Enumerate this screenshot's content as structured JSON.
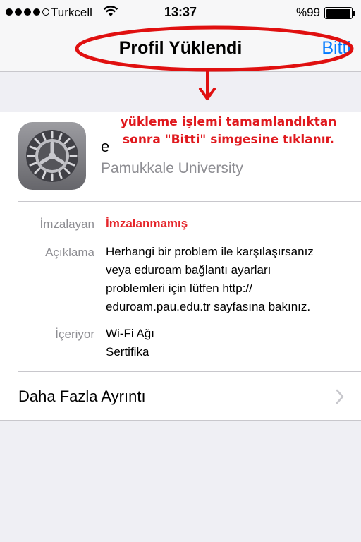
{
  "status_bar": {
    "carrier": "Turkcell",
    "signal_bars": 4,
    "signal_max": 5,
    "time": "13:37",
    "battery_percent": "%99",
    "battery_level": 0.99
  },
  "nav": {
    "title": "Profil Yüklendi",
    "done_label": "Bitti",
    "done_color": "#007aff"
  },
  "annotation": {
    "line1": "yükleme işlemi tamamlandıktan",
    "line2": "sonra \"Bitti\" simgesine tıklanır.",
    "color": "#e0191e"
  },
  "profile": {
    "icon": "settings-gear-icon",
    "name": "e",
    "organization": "Pamukkale University"
  },
  "details": {
    "signed_by_label": "İmzalayan",
    "signed_by_value": "İmzalanmamış",
    "description_label": "Açıklama",
    "description_lines": [
      "Herhangi bir problem ile karşılaşırsanız",
      "veya eduroam bağlantı ayarları",
      "problemleri için lütfen http://",
      "eduroam.pau.edu.tr sayfasına bakınız."
    ],
    "contains_label": "İçeriyor",
    "contains_items": [
      "Wi-Fi Ağı",
      "Sertifika"
    ]
  },
  "more_details": {
    "label": "Daha Fazla Ayrıntı"
  }
}
